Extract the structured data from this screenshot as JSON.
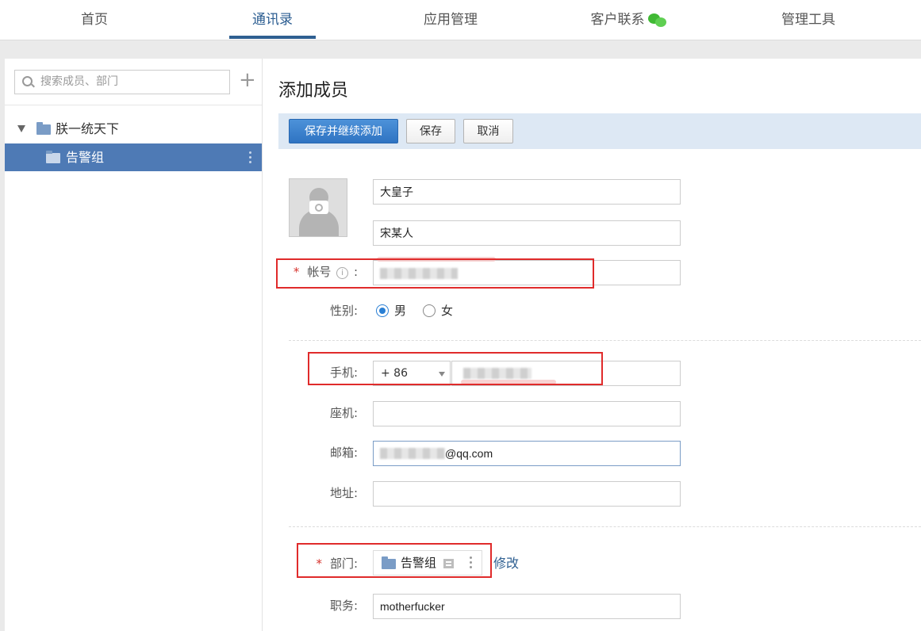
{
  "nav": {
    "tabs": [
      "首页",
      "通讯录",
      "应用管理",
      "客户联系",
      "管理工具"
    ],
    "active_index": 1,
    "wechat_icon": "wechat-icon",
    "accent": "#2e5f91"
  },
  "sidebar": {
    "search_placeholder": "搜索成员、部门",
    "add_icon": "plus-icon",
    "tree": {
      "root": "朕一统天下",
      "selected": "告警组"
    },
    "selected_color": "#4e7ab5"
  },
  "form": {
    "title": "添加成员",
    "buttons": {
      "save_continue": "保存并继续添加",
      "save": "保存",
      "cancel": "取消"
    },
    "name": "大皇子",
    "alias": "宋某人",
    "account_label": "帐号",
    "gender_label": "性别:",
    "gender_male": "男",
    "gender_female": "女",
    "gender_selected": "男",
    "mobile_label": "手机:",
    "country_code": "+ 86",
    "phone_label": "座机:",
    "email_label": "邮箱:",
    "email_suffix": "@qq.com",
    "address_label": "地址:",
    "dept_label": "部门:",
    "dept_value": "告警组",
    "dept_modify": "修改",
    "position_label": "职务:",
    "position_value": "motherfucker",
    "required_mark": "*",
    "colon": ":",
    "info_icon": "i"
  }
}
